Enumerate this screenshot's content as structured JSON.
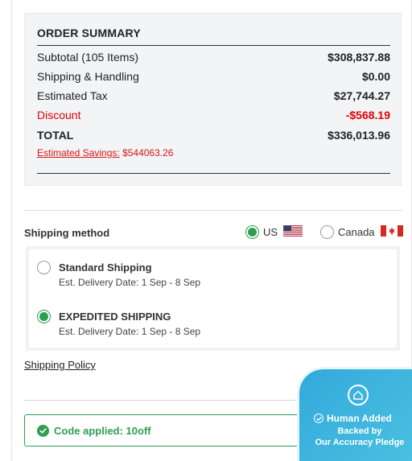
{
  "order_summary": {
    "title": "ORDER SUMMARY",
    "subtotal_label": "Subtotal (105 Items)",
    "subtotal_value": "$308,837.88",
    "shipping_label": "Shipping & Handling",
    "shipping_value": "$0.00",
    "tax_label": "Estimated Tax",
    "tax_value": "$27,744.27",
    "discount_label": "Discount",
    "discount_value": "-$568.19",
    "total_label": "TOTAL",
    "total_value": "$336,013.96",
    "savings_link": "Estimated Savings:",
    "savings_value": "$544063.26"
  },
  "shipping": {
    "label": "Shipping method",
    "countries": [
      {
        "name": "US",
        "selected": true,
        "flag": "us-flag-icon"
      },
      {
        "name": "Canada",
        "selected": false,
        "flag": "canada-flag-icon"
      }
    ],
    "options": [
      {
        "name": "Standard Shipping",
        "date": "Est. Delivery Date: 1 Sep - 8 Sep",
        "selected": false
      },
      {
        "name": "EXPEDITED SHIPPING",
        "date": "Est. Delivery Date: 1 Sep - 8 Sep",
        "selected": true
      }
    ],
    "policy_link": "Shipping Policy"
  },
  "promo": {
    "applied_text": "Code applied: 10off"
  },
  "badge": {
    "line1": "Human Added",
    "line2": "Backed by",
    "line3": "Our Accuracy Pledge"
  },
  "colors": {
    "accent_green": "#2e9e4f",
    "discount_red": "#e00000",
    "badge_blue": "#33a9dc"
  }
}
